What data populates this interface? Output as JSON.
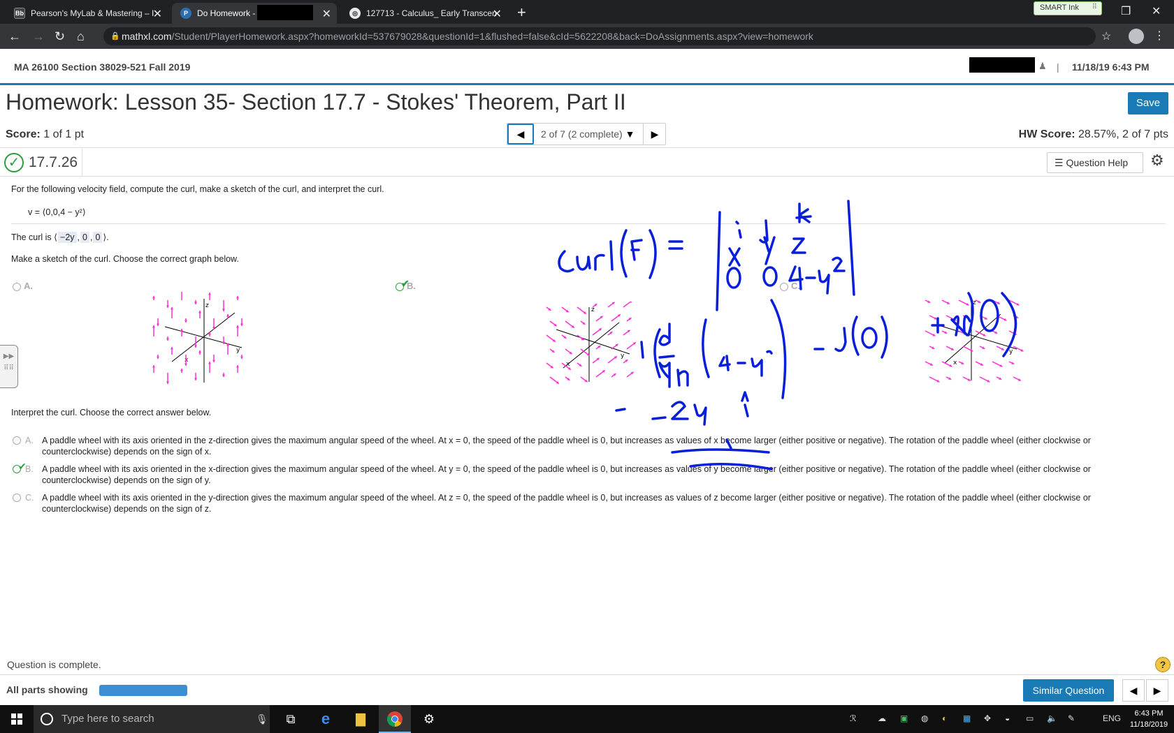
{
  "browser": {
    "tabs": [
      {
        "icon": "Bb",
        "label": "Pearson's MyLab & Mastering – I"
      },
      {
        "icon": "P",
        "label": "Do Homework -"
      },
      {
        "icon": "",
        "label": "127713 - Calculus_ Early Transcen"
      }
    ],
    "smart_ink": "SMART Ink",
    "url_host": "mathxl.com",
    "url_path": "/Student/PlayerHomework.aspx?homeworkId=537679028&questionId=1&flushed=false&cId=5622208&back=DoAssignments.aspx?view=homework"
  },
  "header": {
    "course": "MA 26100 Section 38029-521 Fall 2019",
    "separator": "|",
    "datetime": "11/18/19 6:43 PM"
  },
  "homework": {
    "title": "Homework: Lesson 35- Section 17.7 - Stokes' Theorem, Part II",
    "save": "Save",
    "score_label": "Score:",
    "score_value": "1 of 1 pt",
    "nav_label": "2 of 7 (2 complete)",
    "hw_score_label": "HW Score:",
    "hw_score_value": "28.57%, 2 of 7 pts",
    "question_id": "17.7.26",
    "question_help": "Question Help"
  },
  "question": {
    "prompt": "For the following velocity field, compute the curl, make a sketch of the curl, and interpret the curl.",
    "equation": "v = ⟨0,0,4 − y²⟩",
    "curl_prefix": "The curl is",
    "curl_answers": [
      "−2y",
      "0",
      "0"
    ],
    "sketch_prompt": "Make a sketch of the curl. Choose the correct graph below.",
    "graph_options": [
      "A.",
      "B.",
      "C."
    ],
    "graph_axes": [
      "z",
      "x",
      "y"
    ],
    "interpret_prompt": "Interpret the curl. Choose the correct answer below.",
    "answers": [
      {
        "letter": "A.",
        "text": "A paddle wheel with its axis oriented in the z-direction gives the maximum angular speed of the wheel. At x = 0, the speed of the paddle wheel is 0, but increases as values of x become larger (either positive or negative). The rotation of the paddle wheel (either clockwise or counterclockwise) depends on the sign of x."
      },
      {
        "letter": "B.",
        "text": "A paddle wheel with its axis oriented in the x-direction gives the maximum angular speed of the wheel. At y = 0, the speed of the paddle wheel is 0, but increases as values of y become larger (either positive or negative). The rotation of the paddle wheel (either clockwise or counterclockwise) depends on the sign of y."
      },
      {
        "letter": "C.",
        "text": "A paddle wheel with its axis oriented in the y-direction gives the maximum angular speed of the wheel. At z = 0, the speed of the paddle wheel is 0, but increases as values of z become larger (either positive or negative). The rotation of the paddle wheel (either clockwise or counterclockwise) depends on the sign of z."
      }
    ]
  },
  "footer": {
    "status": "Question is complete.",
    "parts": "All parts showing",
    "similar": "Similar Question"
  },
  "taskbar": {
    "search_placeholder": "Type here to search",
    "lang": "ENG",
    "time": "6:43 PM",
    "date": "11/18/2019"
  },
  "colors": {
    "accent": "#1a7ab5",
    "correct": "#2e9e3b",
    "arrows": "#ff2fd6",
    "ink": "#0a1fd8"
  }
}
